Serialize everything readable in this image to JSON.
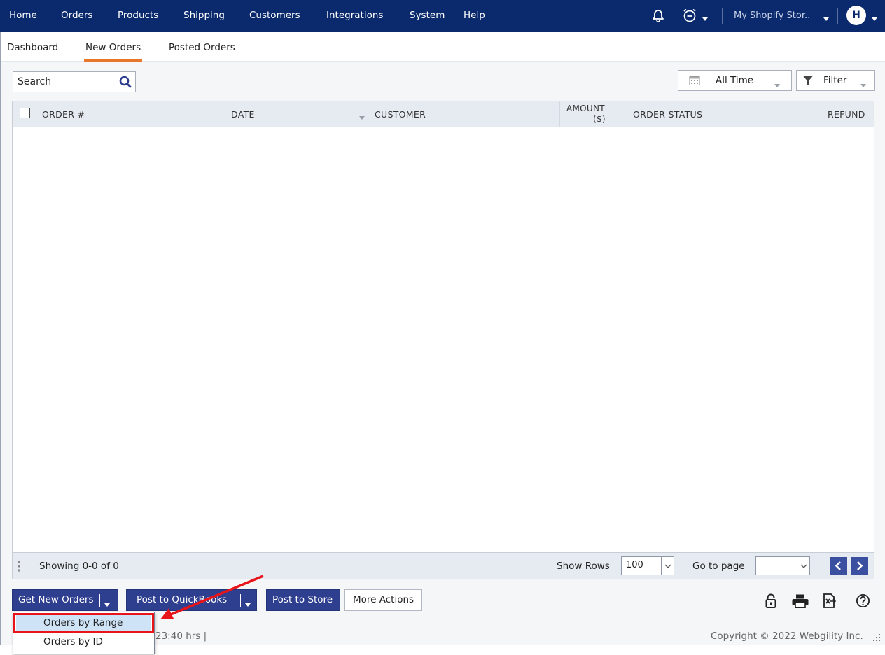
{
  "nav": {
    "items": [
      "Home",
      "Orders",
      "Products",
      "Shipping",
      "Customers",
      "Integrations",
      "System",
      "Help"
    ],
    "store": "My Shopify Stor..",
    "avatar": "H"
  },
  "tabs": [
    "Dashboard",
    "New Orders",
    "Posted Orders"
  ],
  "search": {
    "placeholder": "Search"
  },
  "date_filter": "All Time",
  "filter_label": "Filter",
  "table": {
    "columns": [
      "ORDER #",
      "DATE",
      "CUSTOMER",
      "AMOUNT",
      "($)",
      "ORDER STATUS",
      "REFUND"
    ]
  },
  "pager": {
    "showing": "Showing 0-0 of 0",
    "show_rows_label": "Show Rows",
    "rows": "100",
    "goto_label": "Go to page"
  },
  "actions": {
    "get_new_orders": "Get New Orders",
    "post_to_qb": "Post to QuickBooks",
    "post_to_store": "Post to Store",
    "more_actions": "More Actions"
  },
  "menu": [
    "Orders by Range",
    "Orders by ID"
  ],
  "footer": {
    "time": "23:40 hrs |",
    "copyright": "Copyright © 2022 Webgility Inc."
  },
  "colors": {
    "nav_bg": "#0b2a6e",
    "accent_tab": "#e8772e",
    "button_bg": "#2f3f8f",
    "annotation": "#e8141a"
  }
}
